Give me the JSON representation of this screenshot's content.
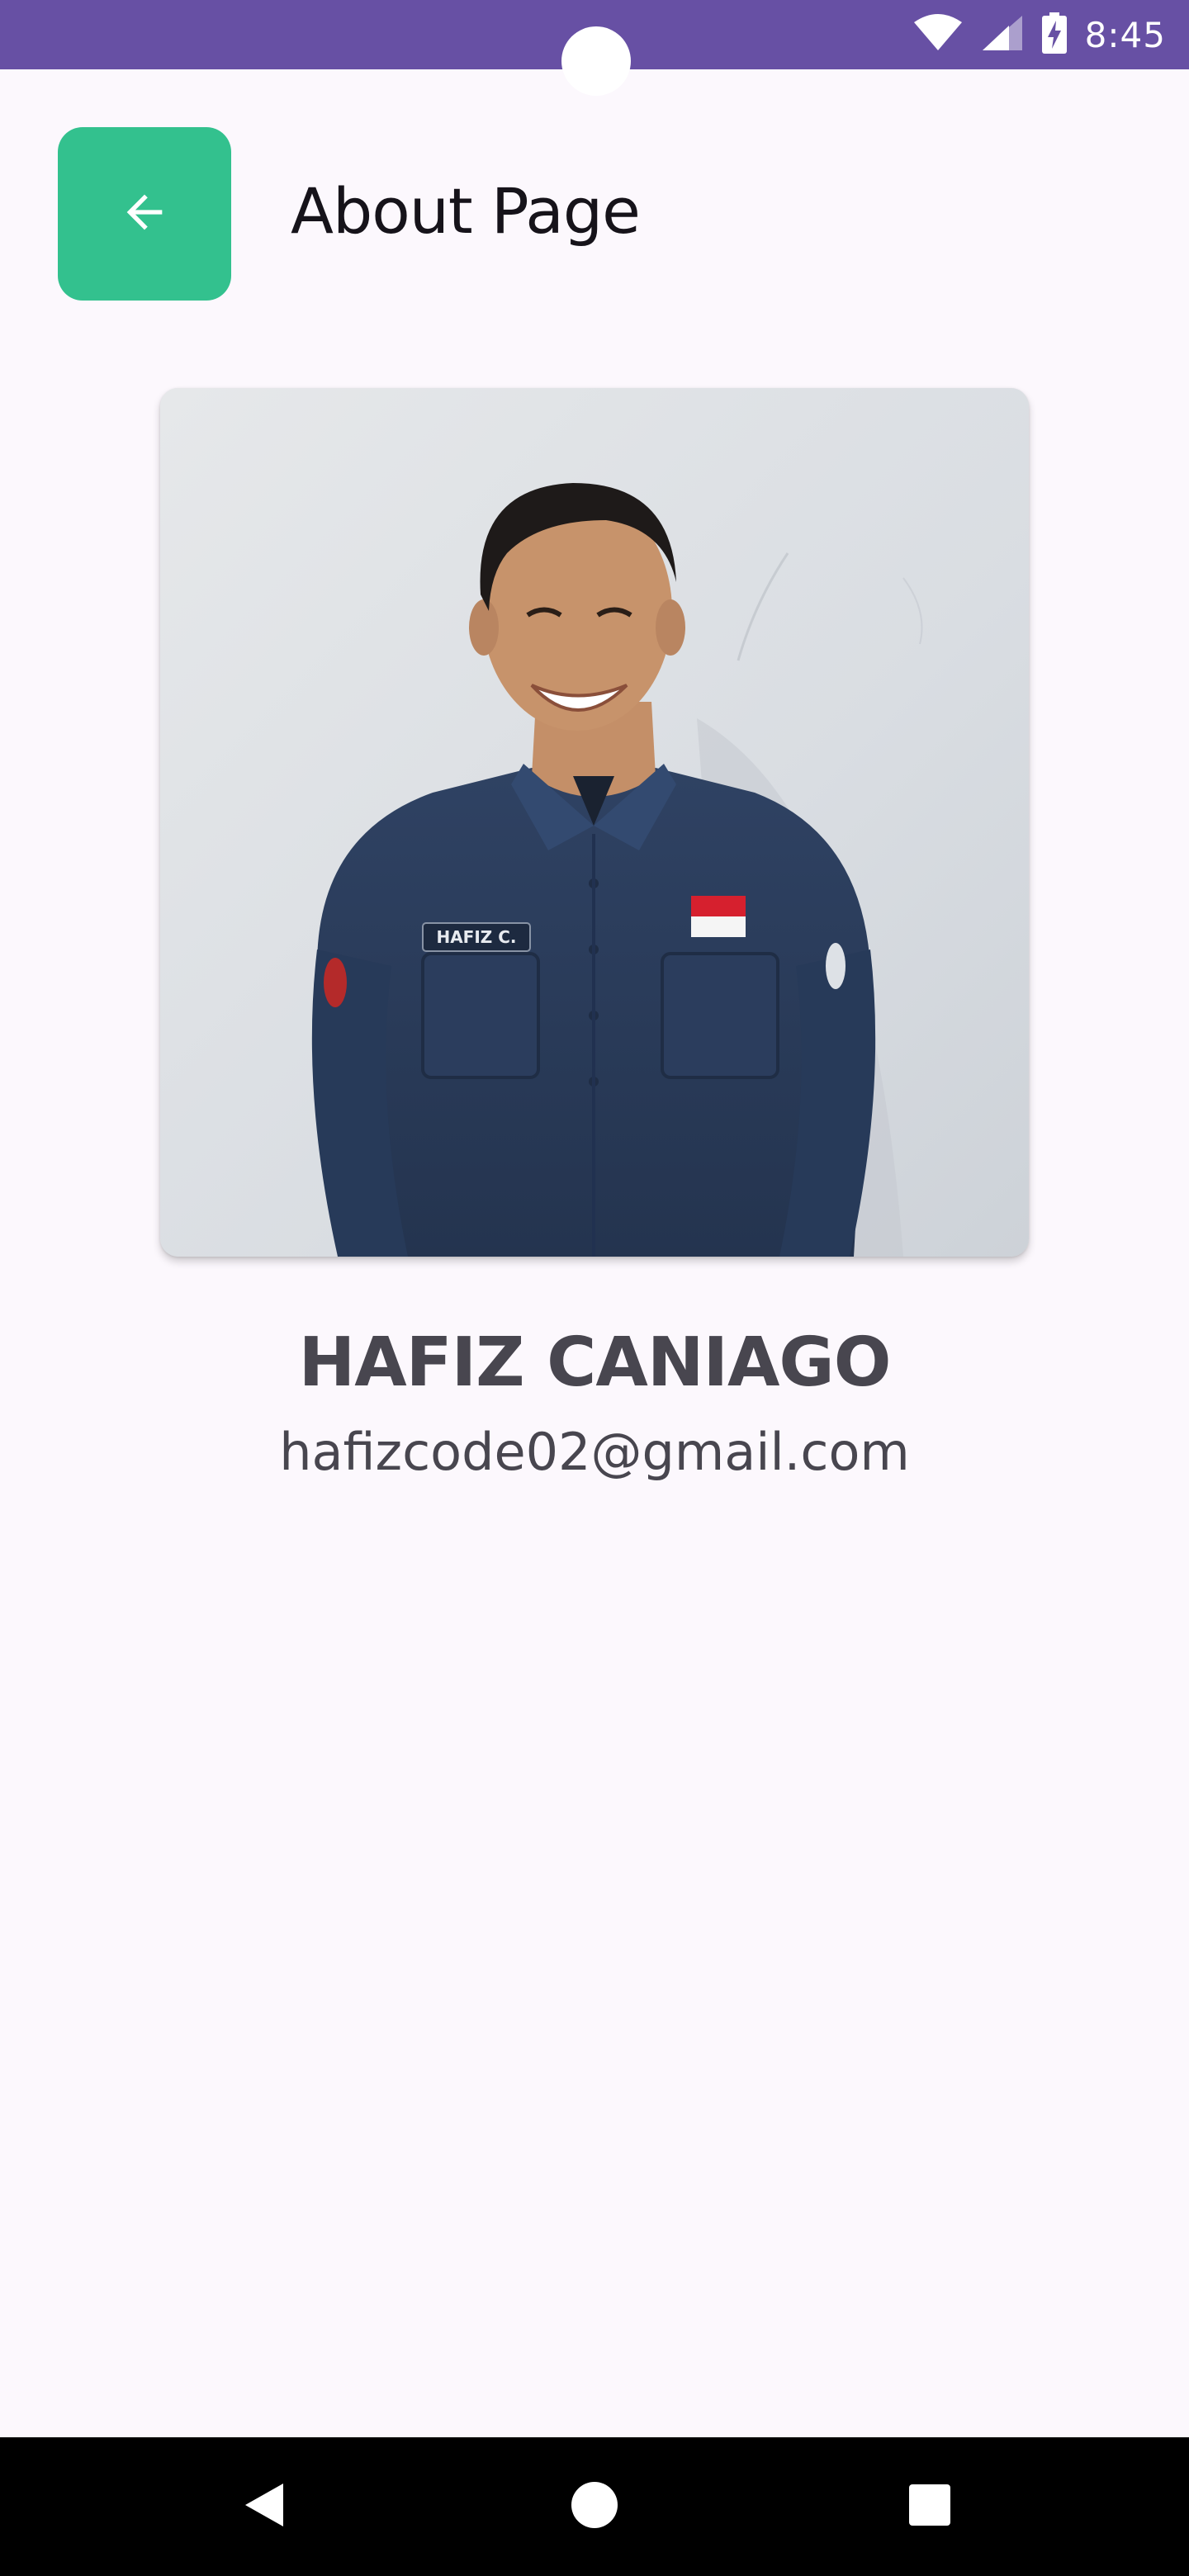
{
  "status_bar": {
    "time": "8:45",
    "icons": [
      "wifi-icon",
      "cellular-signal-icon",
      "battery-charging-icon"
    ],
    "background": "#6750a4"
  },
  "header": {
    "back_icon": "arrow-left-icon",
    "back_button_color": "#33c18e",
    "title": "About Page"
  },
  "profile": {
    "photo_name_tag": "HAFIZ C.",
    "name": "HAFIZ CANIAGO",
    "email": "hafizcode02@gmail.com"
  },
  "navigation_bar": {
    "buttons": [
      "back-triangle-icon",
      "home-circle-icon",
      "recents-square-icon"
    ]
  },
  "colors": {
    "page_background": "#fcf8fd",
    "accent": "#33c18e",
    "text_primary": "#16131a",
    "text_secondary": "#48464f"
  }
}
